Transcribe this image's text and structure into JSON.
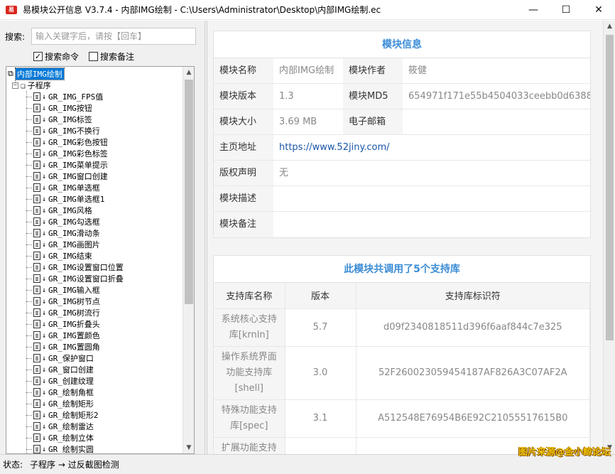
{
  "window": {
    "app_icon": "易",
    "title": "易模块公开信息 V3.7.4 - 内部IMG绘制 - C:\\Users\\Administrator\\Desktop\\内部IMG绘制.ec",
    "min_glyph": "—",
    "max_glyph": "☐",
    "close_glyph": "✕"
  },
  "search": {
    "label": "搜索:",
    "placeholder": "输入关键字后，请按【回车】",
    "options": [
      {
        "label": "搜索命令",
        "checked": true
      },
      {
        "label": "搜索备注",
        "checked": false
      }
    ]
  },
  "tree": {
    "root": "内部IMG绘制",
    "group": "子程序",
    "items": [
      "GR_IMG_FPS值",
      "GR_IMG按钮",
      "GR_IMG标签",
      "GR_IMG不换行",
      "GR_IMG彩色按钮",
      "GR_IMG彩色标签",
      "GR_IMG菜单提示",
      "GR_IMG窗口创建",
      "GR_IMG单选框",
      "GR_IMG单选框1",
      "GR_IMG风格",
      "GR_IMG勾选框",
      "GR_IMG滑动条",
      "GR_IMG画图片",
      "GR_IMG结束",
      "GR_IMG设置窗口位置",
      "GR_IMG设置窗口折叠",
      "GR_IMG输入框",
      "GR_IMG树节点",
      "GR_IMG树流行",
      "GR_IMG折叠头",
      "GR_IMG置颜色",
      "GR_IMG置圆角",
      "GR_保护窗口",
      "GR_窗口创建",
      "GR_创建纹理",
      "GR_绘制角框",
      "GR_绘制矩形",
      "GR_绘制矩形2",
      "GR_绘制雷达",
      "GR_绘制立体",
      "GR_绘制实圆"
    ]
  },
  "module_info": {
    "title": "模块信息",
    "name_label": "模块名称",
    "name_value": "内部IMG绘制",
    "author_label": "模块作者",
    "author_value": "筱健",
    "version_label": "模块版本",
    "version_value": "1.3",
    "md5_label": "模块MD5",
    "md5_value": "654971f171e55b4504033ceebb0d6388",
    "size_label": "模块大小",
    "size_value": "3.69 MB",
    "email_label": "电子邮箱",
    "email_value": "",
    "homepage_label": "主页地址",
    "homepage_value": "https://www.52jiny.com/",
    "copyright_label": "版权声明",
    "copyright_value": "无",
    "desc_label": "模块描述",
    "desc_value": "",
    "remark_label": "模块备注",
    "remark_value": ""
  },
  "libraries": {
    "title": "此模块共调用了5个支持库",
    "headers": [
      "支持库名称",
      "版本",
      "支持库标识符"
    ],
    "rows": [
      {
        "name": "系统核心支持库[krnln]",
        "version": "5.7",
        "id": "d09f2340818511d396f6aaf844c7e325"
      },
      {
        "name": "操作系统界面功能支持库[shell]",
        "version": "3.0",
        "id": "52F260023059454187AF826A3C07AF2A"
      },
      {
        "name": "特殊功能支持库[spec]",
        "version": "3.1",
        "id": "A512548E76954B6E92C21055517615B0"
      },
      {
        "name": "扩展功能支持",
        "version": "",
        "id": ""
      }
    ]
  },
  "status": {
    "label": "状态:",
    "text": "子程序 → 过反截图检测"
  },
  "watermark": "图片来源@金小鲸论坛",
  "colors": {
    "accent": "#3c8dd6",
    "selection": "#0078d7",
    "link": "#1a56a8",
    "watermark": "#f2c200"
  }
}
